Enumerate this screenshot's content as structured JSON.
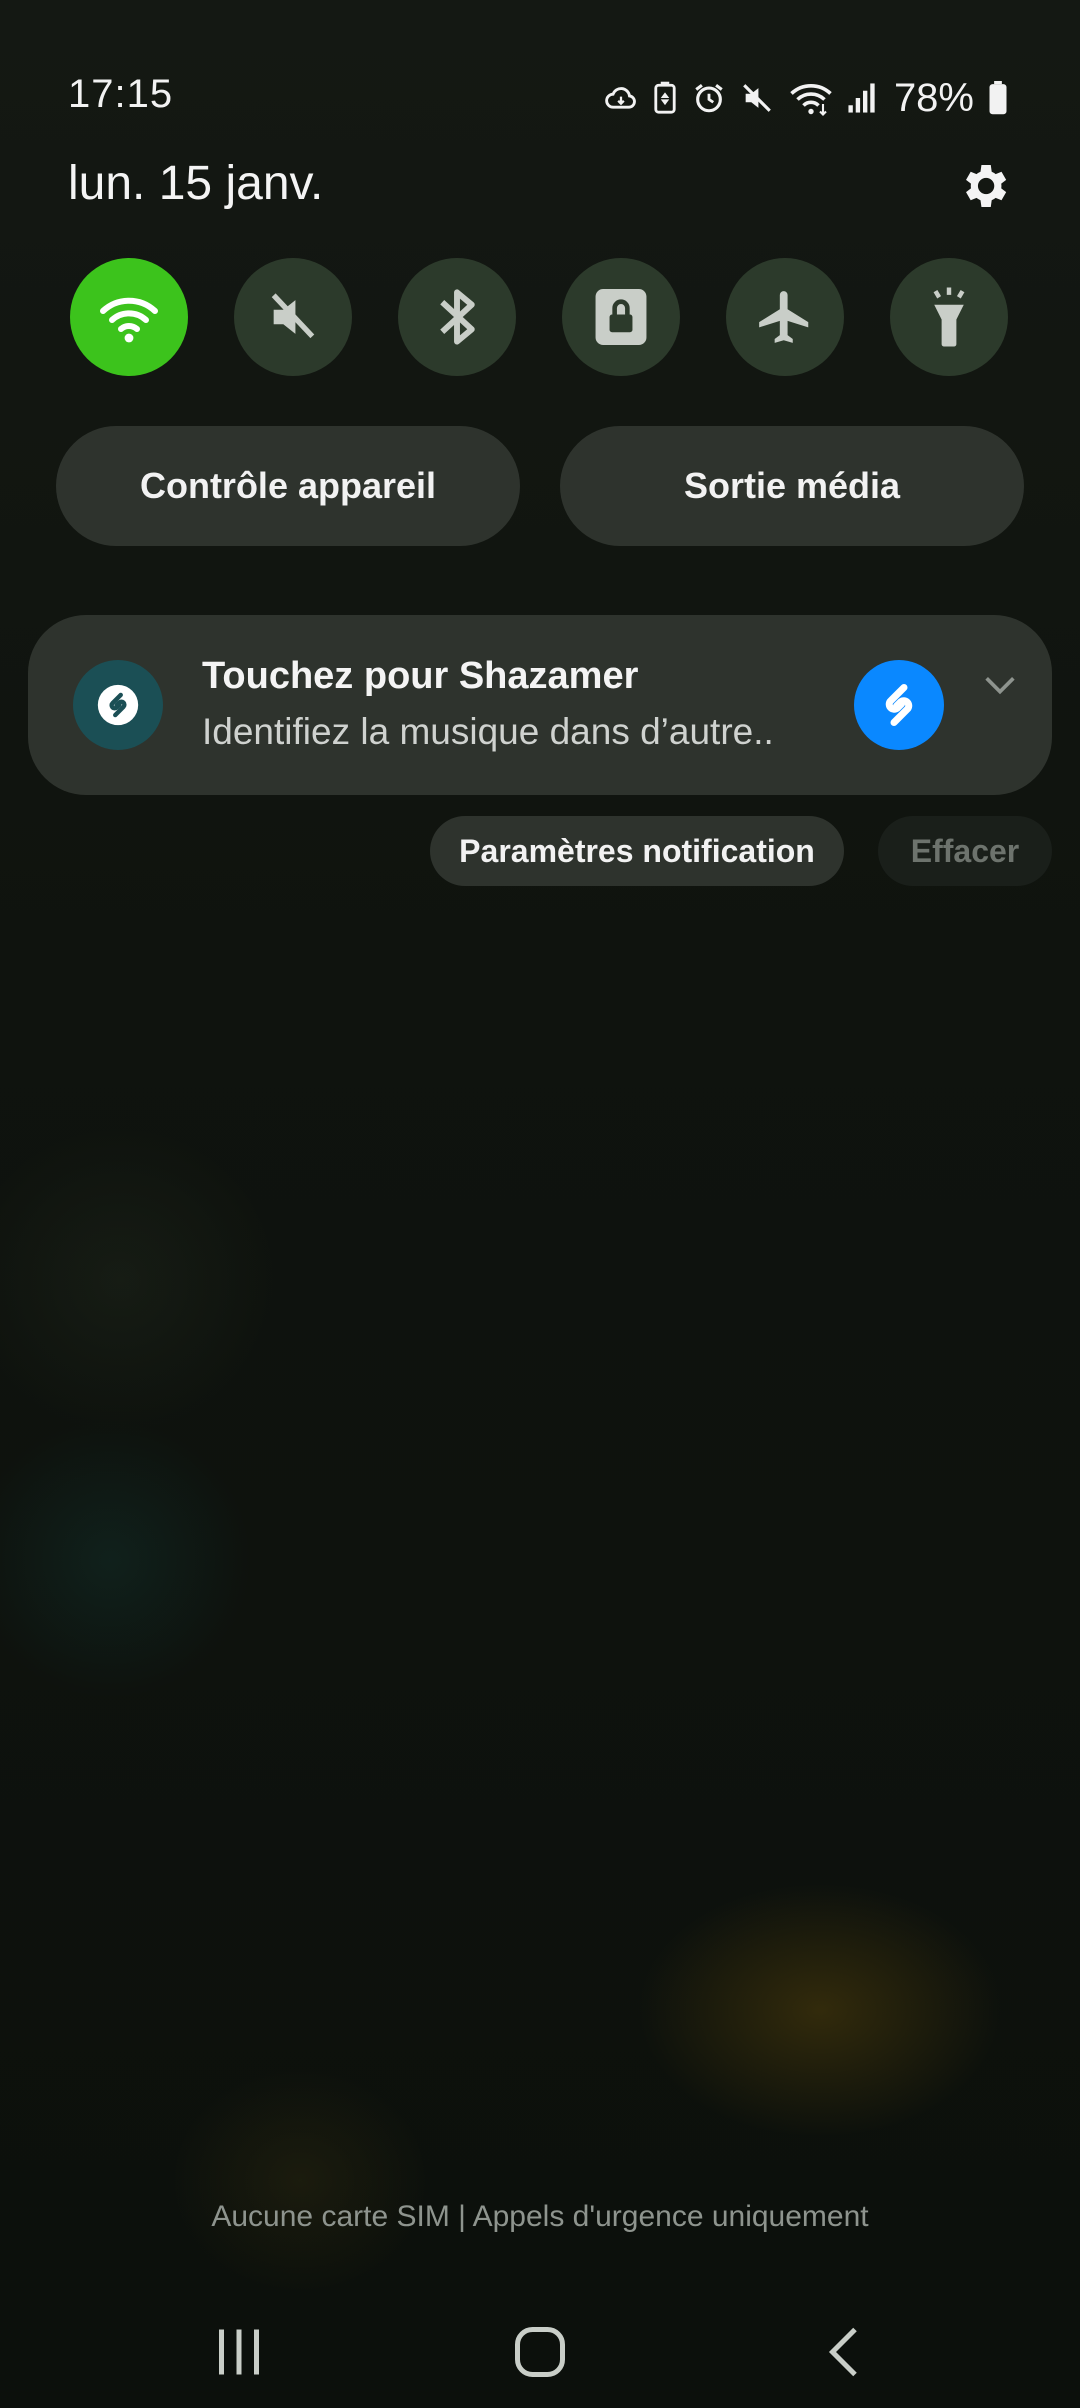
{
  "status_bar": {
    "time": "17:15",
    "battery_percent": "78%",
    "icons": [
      "cloud-sync-icon",
      "battery-saver-icon",
      "alarm-icon",
      "mute-icon",
      "wifi-icon",
      "signal-icon",
      "battery-icon"
    ]
  },
  "header": {
    "date": "lun. 15 janv.",
    "settings_icon": "gear-icon"
  },
  "quick_toggles": [
    {
      "name": "wifi",
      "icon": "wifi-icon",
      "active": true
    },
    {
      "name": "sound",
      "icon": "mute-icon",
      "active": false
    },
    {
      "name": "bluetooth",
      "icon": "bluetooth-icon",
      "active": false
    },
    {
      "name": "rotation-lock",
      "icon": "lock-icon",
      "active": false
    },
    {
      "name": "airplane-mode",
      "icon": "airplane-icon",
      "active": false
    },
    {
      "name": "flashlight",
      "icon": "flashlight-icon",
      "active": false
    }
  ],
  "pills": {
    "device_control": "Contrôle appareil",
    "media_output": "Sortie média"
  },
  "notification": {
    "title": "Touchez pour Shazamer",
    "body": "Identifiez la musique dans d’autre..",
    "app_icon": "shazam-icon"
  },
  "notification_actions": {
    "settings": "Paramètres notification",
    "clear": "Effacer"
  },
  "footer": {
    "sim_text": "Aucune carte SIM | Appels d'urgence uniquement"
  },
  "colors": {
    "accent_green": "#3cc31c",
    "shazam_blue": "#0a88ff",
    "toggle_off": "#2c3a2b"
  }
}
